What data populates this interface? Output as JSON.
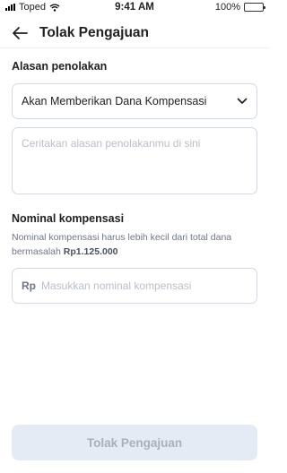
{
  "status_bar": {
    "carrier": "Toped",
    "time": "9:41 AM",
    "battery": "100%"
  },
  "header": {
    "title": "Tolak Pengajuan",
    "back_icon": "arrow-left-icon"
  },
  "rejection": {
    "label": "Alasan penolakan",
    "selected_reason": "Akan Memberikan Dana Kompensasi",
    "dropdown_icon": "chevron-down-icon",
    "textarea_placeholder": "Ceritakan alasan penolakanmu di sini"
  },
  "compensation": {
    "label": "Nominal kompensasi",
    "helper_text": "Nominal kompensasi harus lebih kecil dari total dana bermasalah",
    "helper_amount": "Rp1.125.000",
    "prefix": "Rp",
    "input_placeholder": "Masukkan nominal kompensasi"
  },
  "footer": {
    "submit_label": "Tolak Pengajuan"
  },
  "colors": {
    "border": "#d4d9e0",
    "disabled_button_bg": "#e4ebf5",
    "disabled_button_text": "#a8b0bd",
    "placeholder": "#b9bfc7"
  }
}
